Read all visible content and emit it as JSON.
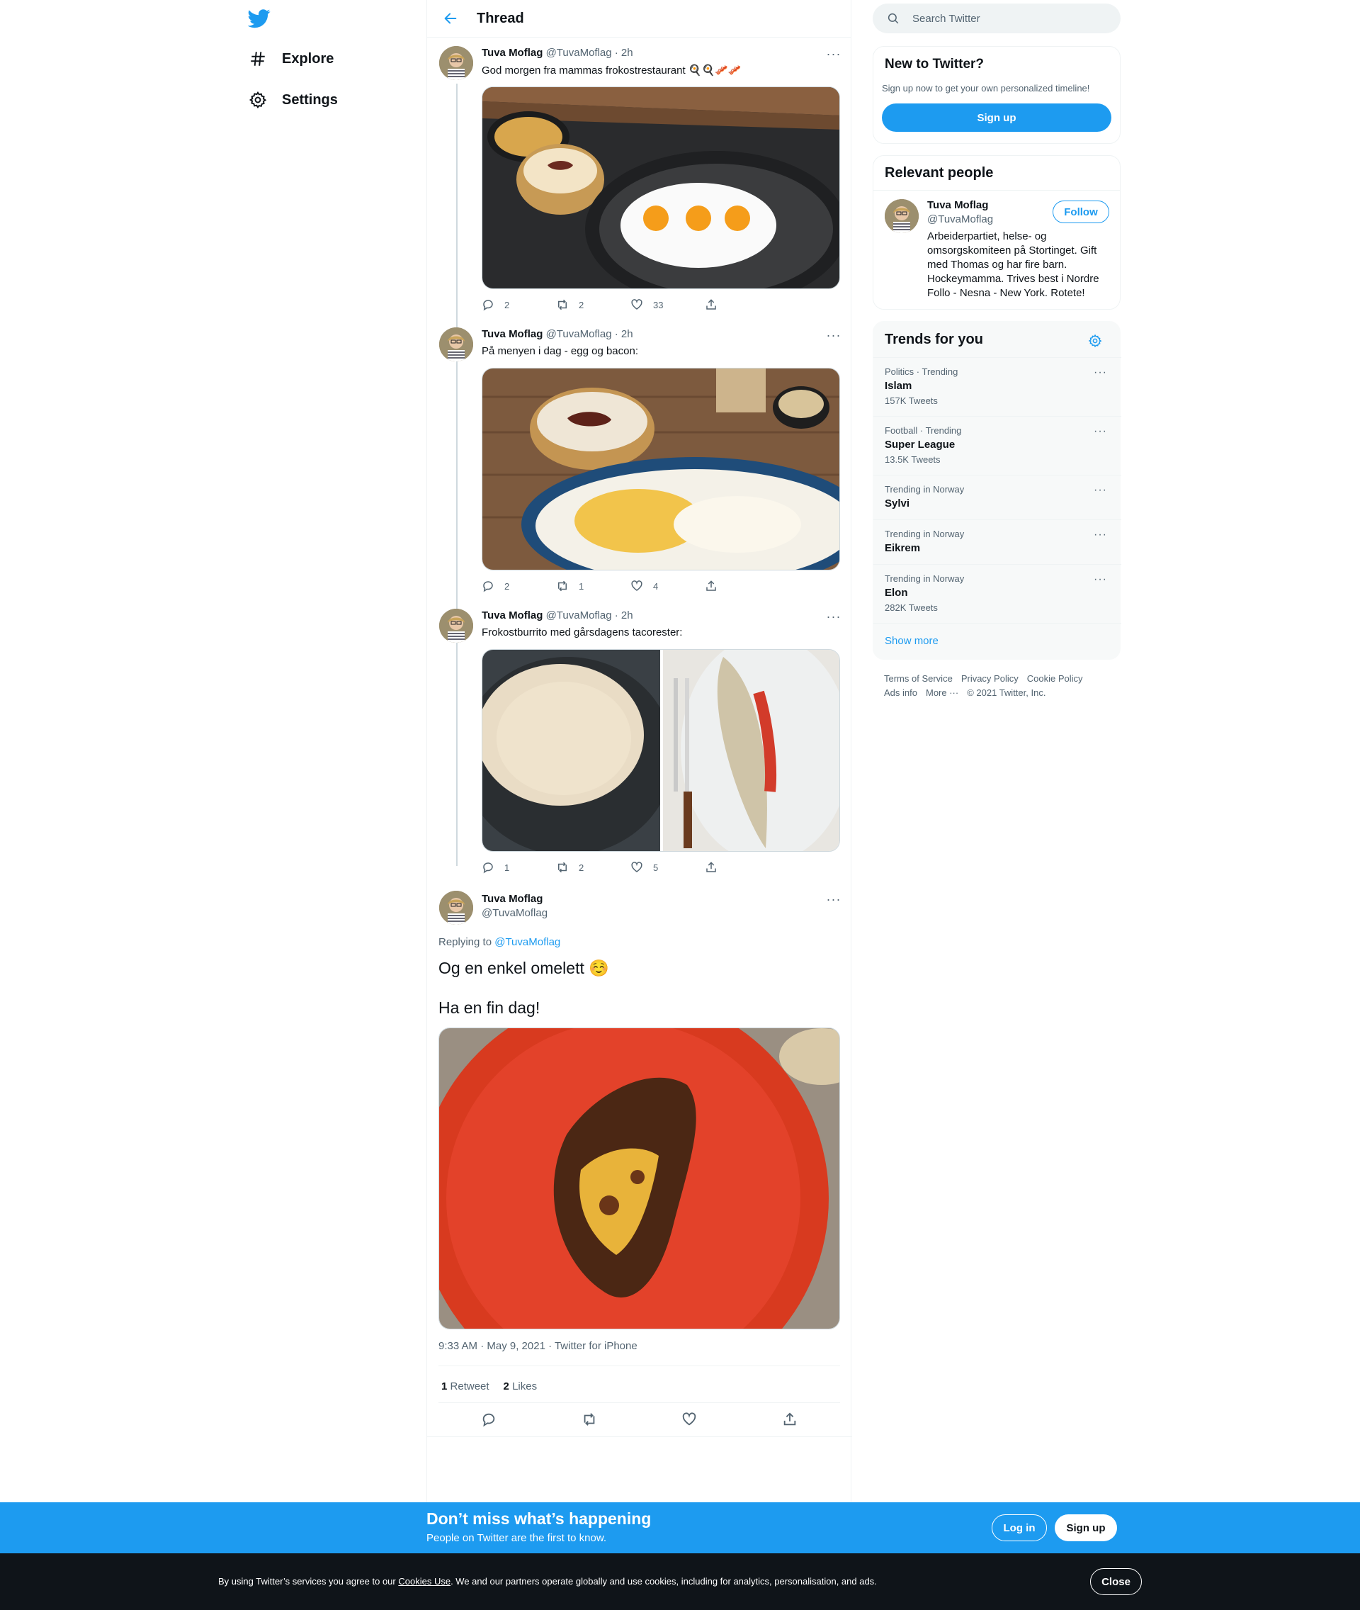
{
  "nav": {
    "explore_label": "Explore",
    "settings_label": "Settings"
  },
  "header": {
    "title": "Thread"
  },
  "tweets": [
    {
      "name": "Tuva Moflag",
      "handle_time": "@TuvaMoflag · 2h",
      "text": "God morgen fra mammas frokostrestaurant 🍳🍳🥓🥓",
      "replies": "2",
      "retweets": "2",
      "likes": "33"
    },
    {
      "name": "Tuva Moflag",
      "handle_time": "@TuvaMoflag · 2h",
      "text": "På menyen i dag - egg og bacon:",
      "replies": "2",
      "retweets": "1",
      "likes": "4"
    },
    {
      "name": "Tuva Moflag",
      "handle_time": "@TuvaMoflag · 2h",
      "text": "Frokostburrito med gårsdagens tacorester:",
      "replies": "1",
      "retweets": "2",
      "likes": "5"
    }
  ],
  "focus": {
    "name": "Tuva Moflag",
    "handle": "@TuvaMoflag",
    "replying_prefix": "Replying to",
    "replying_to": "@TuvaMoflag",
    "text_line1": "Og en enkel omelett ☺️",
    "text_line2": "Ha en fin dag!",
    "timestamp": "9:33 AM · May 9, 2021 · Twitter for iPhone",
    "retweet_count": "1",
    "retweet_label": "Retweet",
    "like_count": "2",
    "like_label": "Likes"
  },
  "search": {
    "placeholder": "Search Twitter"
  },
  "new_to_twitter": {
    "title": "New to Twitter?",
    "subtitle": "Sign up now to get your own personalized timeline!",
    "button": "Sign up"
  },
  "relevant_people": {
    "title": "Relevant people",
    "name": "Tuva Moflag",
    "handle": "@TuvaMoflag",
    "follow_label": "Follow",
    "bio": "Arbeiderpartiet, helse- og omsorgskomiteen på Stortinget. Gift med Thomas og har fire barn. Hockeymamma. Trives best i Nordre Follo - Nesna - New York. Rotete!"
  },
  "trends": {
    "title": "Trends for you",
    "items": [
      {
        "context": "Politics · Trending",
        "topic": "Islam",
        "count": "157K Tweets"
      },
      {
        "context": "Football · Trending",
        "topic": "Super League",
        "count": "13.5K Tweets"
      },
      {
        "context": "Trending in Norway",
        "topic": "Sylvi",
        "count": ""
      },
      {
        "context": "Trending in Norway",
        "topic": "Eikrem",
        "count": ""
      },
      {
        "context": "Trending in Norway",
        "topic": "Elon",
        "count": "282K Tweets"
      }
    ],
    "show_more": "Show more"
  },
  "footer": {
    "terms": "Terms of Service",
    "privacy": "Privacy Policy",
    "cookie": "Cookie Policy",
    "ads": "Ads info",
    "more": "More ···",
    "copyright": "© 2021 Twitter, Inc."
  },
  "banner": {
    "headline": "Don’t miss what’s happening",
    "sub": "People on Twitter are the first to know.",
    "login": "Log in",
    "signup": "Sign up"
  },
  "cookie": {
    "prefix": "By using Twitter’s services you agree to our",
    "link": "Cookies Use",
    "suffix": ". We and our partners operate globally and use cookies, including for analytics, personalisation, and ads.",
    "close": "Close"
  },
  "colors": {
    "accent": "#1d9bf0",
    "text": "#0f1419",
    "muted": "#536471",
    "dark_bar": "#0f1419"
  }
}
